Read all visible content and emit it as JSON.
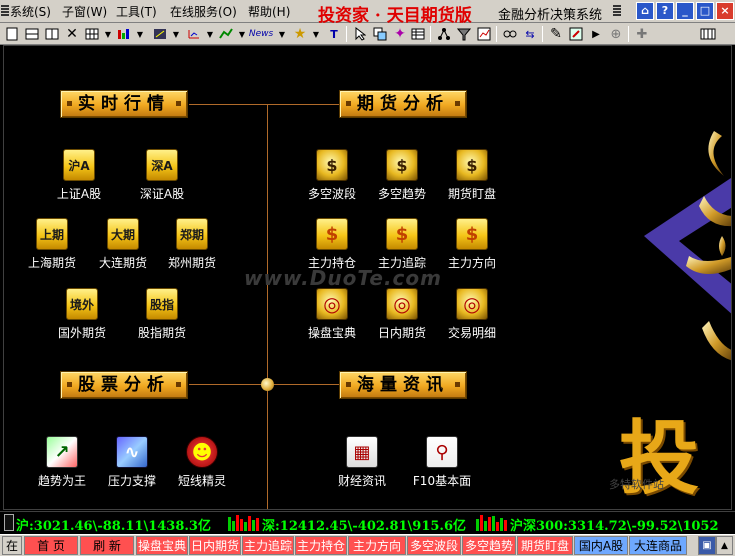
{
  "menubar": {
    "items": [
      "系统(S)",
      "子窗(W)",
      "工具(T)",
      "在线服务(O)",
      "帮助(H)"
    ],
    "title": "投资家 · 天目期货版",
    "subtitle": "金融分析决策系统",
    "window_buttons": [
      "⌂",
      "?",
      "_",
      "□",
      "×"
    ]
  },
  "toolbar": {
    "icons": [
      "new-icon",
      "window-icon",
      "split-icon",
      "close-icon",
      "grid-icon",
      "chart-icon",
      "bar-icon",
      "indicator-icon",
      "line-icon",
      "news-icon",
      "star-icon",
      "text-icon",
      "cursor-icon",
      "layers-icon",
      "magic-icon",
      "table-icon",
      "network-icon",
      "filter-icon",
      "stock-icon",
      "link-icon",
      "pencil-icon",
      "edit-icon",
      "play-icon",
      "expand-icon",
      "plus-icon",
      "keyboard-icon"
    ],
    "news_label": "News"
  },
  "sections": {
    "realtime": "实时行情",
    "futures": "期货分析",
    "stocks": "股票分析",
    "info": "海量资讯"
  },
  "realtime_items": [
    {
      "glyph": "沪A",
      "label": "上证A股"
    },
    {
      "glyph": "深A",
      "label": "深证A股"
    },
    {
      "glyph": "上期",
      "label": "上海期货"
    },
    {
      "glyph": "大期",
      "label": "大连期货"
    },
    {
      "glyph": "郑期",
      "label": "郑州期货"
    },
    {
      "glyph": "境外",
      "label": "国外期货"
    },
    {
      "glyph": "股指",
      "label": "股指期货"
    }
  ],
  "futures_items": [
    {
      "glyph": "$",
      "label": "多空波段"
    },
    {
      "glyph": "$",
      "label": "多空趋势"
    },
    {
      "glyph": "$",
      "label": "期货盯盘"
    },
    {
      "glyph": "$",
      "label": "主力持仓"
    },
    {
      "glyph": "$",
      "label": "主力追踪"
    },
    {
      "glyph": "$",
      "label": "主力方向"
    },
    {
      "glyph": "◎",
      "label": "操盘宝典"
    },
    {
      "glyph": "◎",
      "label": "日内期货"
    },
    {
      "glyph": "◎",
      "label": "交易明细"
    }
  ],
  "stock_items": [
    {
      "glyph": "↗",
      "label": "趋势为王"
    },
    {
      "glyph": "∿",
      "label": "压力支撑"
    },
    {
      "glyph": "☻",
      "label": "短线精灵"
    }
  ],
  "info_items": [
    {
      "glyph": "▦",
      "label": "财经资讯"
    },
    {
      "glyph": "⚲",
      "label": "F10基本面"
    }
  ],
  "watermark": "www.DuoTe.com",
  "big_char": "投",
  "corner_watermark": "多特软件站",
  "quotes": [
    "沪:3021.46\\-88.11\\1438.3亿",
    "深:12412.45\\-402.81\\915.6亿",
    "沪深300:3314.72\\-99.52\\1052"
  ],
  "tabs": [
    "在",
    "首 页",
    "刷 新",
    "操盘宝典",
    "日内期货",
    "主力追踪",
    "主力持仓",
    "主力方向",
    "多空波段",
    "多空趋势",
    "期货盯盘",
    "国内A股",
    "大连商品"
  ],
  "colors": {
    "accent": "#f0a820",
    "quote": "#00ff00",
    "tab_red": "#ff5050",
    "tab_blue": "#6ea8ff"
  }
}
